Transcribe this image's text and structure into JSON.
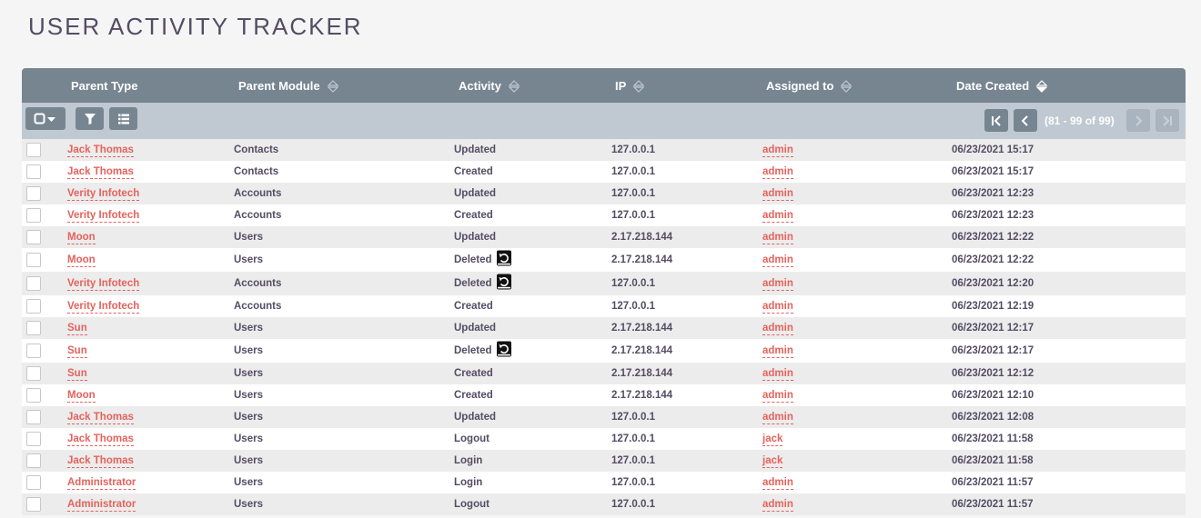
{
  "page": {
    "title": "USER ACTIVITY TRACKER"
  },
  "columns": {
    "parent_type": "Parent Type",
    "parent_module": "Parent Module",
    "activity": "Activity",
    "ip": "IP",
    "assigned_to": "Assigned to",
    "date_created": "Date Created"
  },
  "pagination": {
    "text": "(81 - 99 of 99)"
  },
  "colors": {
    "header": "#778591",
    "toolbar": "#c0c9d1",
    "link": "#e5625c",
    "text": "#534d64"
  },
  "rows": [
    {
      "parent": "Jack Thomas",
      "module": "Contacts",
      "activity": "Updated",
      "ip": "127.0.0.1",
      "assigned": "admin",
      "date": "06/23/2021 15:17",
      "restorable": false
    },
    {
      "parent": "Jack Thomas",
      "module": "Contacts",
      "activity": "Created",
      "ip": "127.0.0.1",
      "assigned": "admin",
      "date": "06/23/2021 15:17",
      "restorable": false
    },
    {
      "parent": "Verity Infotech",
      "module": "Accounts",
      "activity": "Updated",
      "ip": "127.0.0.1",
      "assigned": "admin",
      "date": "06/23/2021 12:23",
      "restorable": false
    },
    {
      "parent": "Verity Infotech",
      "module": "Accounts",
      "activity": "Created",
      "ip": "127.0.0.1",
      "assigned": "admin",
      "date": "06/23/2021 12:23",
      "restorable": false
    },
    {
      "parent": "Moon",
      "module": "Users",
      "activity": "Updated",
      "ip": "2.17.218.144",
      "assigned": "admin",
      "date": "06/23/2021 12:22",
      "restorable": false
    },
    {
      "parent": "Moon",
      "module": "Users",
      "activity": "Deleted",
      "ip": "2.17.218.144",
      "assigned": "admin",
      "date": "06/23/2021 12:22",
      "restorable": true
    },
    {
      "parent": "Verity Infotech",
      "module": "Accounts",
      "activity": "Deleted",
      "ip": "127.0.0.1",
      "assigned": "admin",
      "date": "06/23/2021 12:20",
      "restorable": true
    },
    {
      "parent": "Verity Infotech",
      "module": "Accounts",
      "activity": "Created",
      "ip": "127.0.0.1",
      "assigned": "admin",
      "date": "06/23/2021 12:19",
      "restorable": false
    },
    {
      "parent": "Sun",
      "module": "Users",
      "activity": "Updated",
      "ip": "2.17.218.144",
      "assigned": "admin",
      "date": "06/23/2021 12:17",
      "restorable": false
    },
    {
      "parent": "Sun",
      "module": "Users",
      "activity": "Deleted",
      "ip": "2.17.218.144",
      "assigned": "admin",
      "date": "06/23/2021 12:17",
      "restorable": true
    },
    {
      "parent": "Sun",
      "module": "Users",
      "activity": "Created",
      "ip": "2.17.218.144",
      "assigned": "admin",
      "date": "06/23/2021 12:12",
      "restorable": false
    },
    {
      "parent": "Moon",
      "module": "Users",
      "activity": "Created",
      "ip": "2.17.218.144",
      "assigned": "admin",
      "date": "06/23/2021 12:10",
      "restorable": false
    },
    {
      "parent": "Jack Thomas",
      "module": "Users",
      "activity": "Updated",
      "ip": "127.0.0.1",
      "assigned": "admin",
      "date": "06/23/2021 12:08",
      "restorable": false
    },
    {
      "parent": "Jack Thomas",
      "module": "Users",
      "activity": "Logout",
      "ip": "127.0.0.1",
      "assigned": "jack",
      "date": "06/23/2021 11:58",
      "restorable": false
    },
    {
      "parent": "Jack Thomas",
      "module": "Users",
      "activity": "Login",
      "ip": "127.0.0.1",
      "assigned": "jack",
      "date": "06/23/2021 11:58",
      "restorable": false
    },
    {
      "parent": "Administrator",
      "module": "Users",
      "activity": "Login",
      "ip": "127.0.0.1",
      "assigned": "admin",
      "date": "06/23/2021 11:57",
      "restorable": false
    },
    {
      "parent": "Administrator",
      "module": "Users",
      "activity": "Logout",
      "ip": "127.0.0.1",
      "assigned": "admin",
      "date": "06/23/2021 11:57",
      "restorable": false
    }
  ]
}
